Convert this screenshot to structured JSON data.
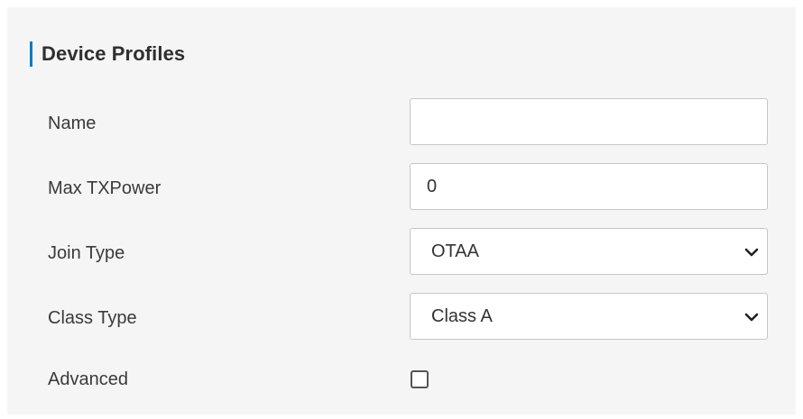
{
  "section": {
    "title": "Device Profiles"
  },
  "form": {
    "name": {
      "label": "Name",
      "value": ""
    },
    "max_txpower": {
      "label": "Max TXPower",
      "value": "0"
    },
    "join_type": {
      "label": "Join Type",
      "selected": "OTAA",
      "icon": "chevron-down-icon"
    },
    "class_type": {
      "label": "Class Type",
      "selected": "Class A",
      "icon": "chevron-down-icon"
    },
    "advanced": {
      "label": "Advanced",
      "checked": false
    }
  },
  "colors": {
    "accent": "#0a7cc2",
    "panel_background": "#f5f5f5",
    "field_border": "#c6c6c6"
  }
}
